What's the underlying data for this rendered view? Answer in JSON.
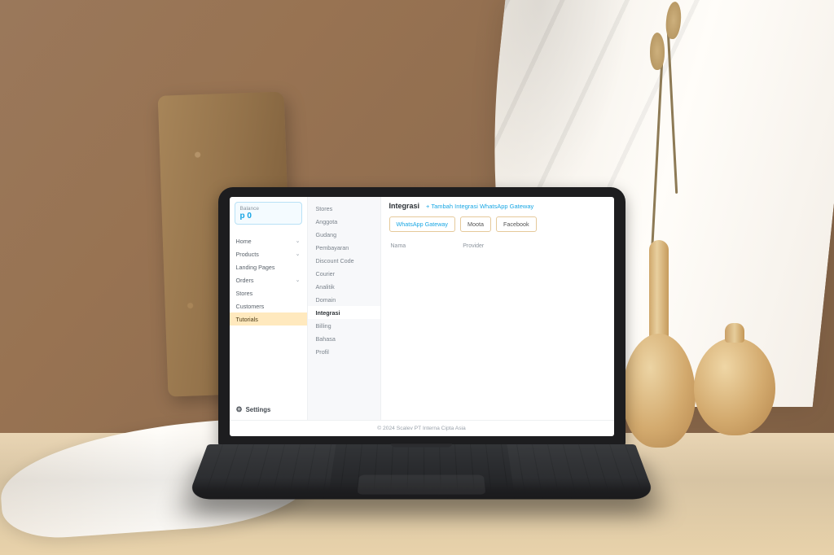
{
  "balance": {
    "label": "Balance",
    "amount_prefix": "p",
    "amount": "0"
  },
  "nav_primary": [
    {
      "label": "Home",
      "has_chevron": true
    },
    {
      "label": "Products",
      "has_chevron": true
    },
    {
      "label": "Landing Pages",
      "has_chevron": false
    },
    {
      "label": "Orders",
      "has_chevron": true
    },
    {
      "label": "Stores",
      "has_chevron": false
    },
    {
      "label": "Customers",
      "has_chevron": false
    },
    {
      "label": "Tutorials",
      "has_chevron": false,
      "active": true
    }
  ],
  "nav_primary_footer": "Settings",
  "nav_secondary": [
    {
      "label": "Stores"
    },
    {
      "label": "Anggota"
    },
    {
      "label": "Gudang"
    },
    {
      "label": "Pembayaran"
    },
    {
      "label": "Discount Code"
    },
    {
      "label": "Courier"
    },
    {
      "label": "Analitik"
    },
    {
      "label": "Domain"
    },
    {
      "label": "Integrasi",
      "active": true
    },
    {
      "label": "Billing"
    },
    {
      "label": "Bahasa"
    },
    {
      "label": "Profil"
    }
  ],
  "content": {
    "title": "Integrasi",
    "add_link": "+ Tambah Integrasi WhatsApp Gateway",
    "tabs": [
      {
        "label": "WhatsApp Gateway",
        "active": true
      },
      {
        "label": "Moota"
      },
      {
        "label": "Facebook"
      }
    ],
    "table": {
      "col_name": "Nama",
      "col_provider": "Provider"
    }
  },
  "footer": "© 2024 Scalev PT Interna Cipta Asia"
}
